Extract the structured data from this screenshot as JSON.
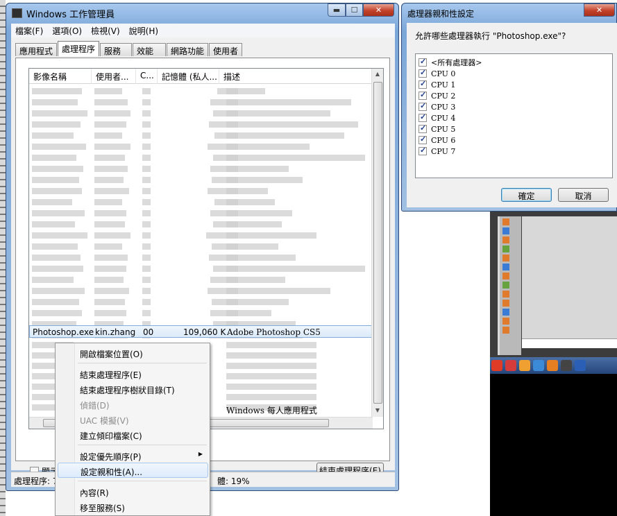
{
  "main_window": {
    "title": "Windows 工作管理員",
    "controls": {
      "minimize": "▬",
      "maximize": "☐",
      "close": "✕"
    },
    "menu": [
      "檔案(F)",
      "選項(O)",
      "檢視(V)",
      "說明(H)"
    ],
    "tabs": [
      "應用程式",
      "處理程序",
      "服務",
      "效能",
      "網路功能",
      "使用者"
    ],
    "active_tab_index": 1,
    "columns": [
      "影像名稱",
      "使用者...",
      "C...",
      "記憶體 (私人...",
      "描述"
    ],
    "selected_row": {
      "image": "Photoshop.exe",
      "user": "kin.zhang",
      "cpu": "00",
      "memory": "109,060 K",
      "description": "Adobe Photoshop CS5"
    },
    "last_row_description": "Windows 每人應用程式",
    "show_all_checkbox_label": "顯示所",
    "end_process_button": "結束處理程序(E)",
    "status_processes": "處理程序: 7:",
    "status_memory": "體: 19%"
  },
  "affinity_dialog": {
    "title": "處理器親和性設定",
    "prompt": "允許哪些處理器執行 \"Photoshop.exe\"?",
    "items": [
      "<所有處理器>",
      "CPU 0",
      "CPU 1",
      "CPU 2",
      "CPU 3",
      "CPU 4",
      "CPU 5",
      "CPU 6",
      "CPU 7"
    ],
    "ok_label": "確定",
    "cancel_label": "取消"
  },
  "context_menu": {
    "items": [
      {
        "label": "開啟檔案位置(O)",
        "enabled": true
      },
      {
        "label": "結束處理程序(E)",
        "enabled": true
      },
      {
        "label": "結束處理程序樹狀目錄(T)",
        "enabled": true
      },
      {
        "label": "偵錯(D)",
        "enabled": false
      },
      {
        "label": "UAC 模擬(V)",
        "enabled": false
      },
      {
        "label": "建立傾印檔案(C)",
        "enabled": true
      },
      {
        "label": "設定優先順序(P)",
        "enabled": true,
        "submenu": true
      },
      {
        "label": "設定親和性(A)...",
        "enabled": true,
        "highlighted": true
      },
      {
        "label": "內容(R)",
        "enabled": true
      },
      {
        "label": "移至服務(S)",
        "enabled": true
      }
    ]
  }
}
